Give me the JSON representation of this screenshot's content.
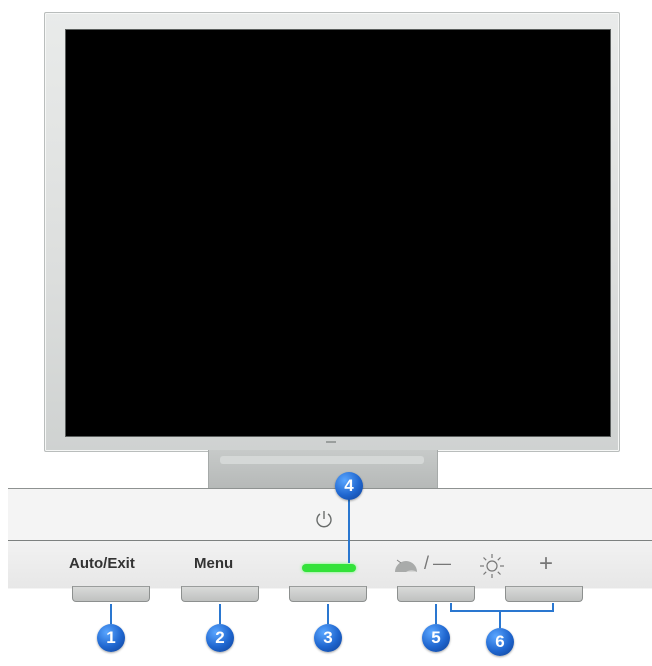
{
  "buttons": [
    {
      "label": "Auto/Exit"
    },
    {
      "label": "Menu"
    },
    {
      "label": ""
    },
    {
      "label": ""
    },
    {
      "label": ""
    }
  ],
  "symbols": {
    "power": "⏻",
    "minus": "—",
    "plus": "+"
  },
  "callouts": [
    "1",
    "2",
    "3",
    "4",
    "5",
    "6"
  ],
  "colors": {
    "led": "#33e23a",
    "callout": "#1f66cf",
    "screen": "#000000"
  }
}
